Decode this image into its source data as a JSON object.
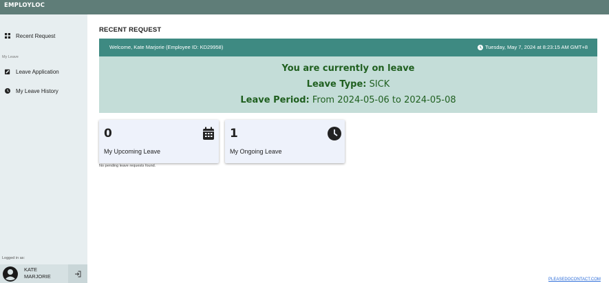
{
  "app": {
    "brand": "EMPLOYLOC"
  },
  "sidebar": {
    "items": [
      {
        "label": "Recent Request",
        "icon": "dashboard-icon"
      },
      {
        "label": "Leave Application",
        "icon": "edit-square-icon"
      },
      {
        "label": "My Leave History",
        "icon": "clock-icon"
      }
    ],
    "section_label": "My Leave",
    "logged_in_label": "Logged in as:",
    "user_name": "KATE MARJORIE"
  },
  "main": {
    "page_title": "RECENT REQUEST",
    "welcome": "Welcome, Kate Marjorie (Employee ID: KD29958)",
    "datetime": "Tuesday, May 7, 2024 at 8:23:15 AM GMT+8",
    "leave_status": {
      "headline": "You are currently on leave",
      "type_label": "Leave Type:",
      "type_value": "SICK",
      "period_label": "Leave Period:",
      "period_value": "From 2024-05-06 to 2024-05-08"
    },
    "cards": [
      {
        "count": "0",
        "caption": "My Upcoming Leave",
        "icon": "calendar-icon"
      },
      {
        "count": "1",
        "caption": "My Ongoing Leave",
        "icon": "clock-icon"
      }
    ],
    "no_pending": "No pending leave requests found."
  },
  "footer": {
    "link_text": "PLEASEDOCONTACT.COM"
  },
  "colors": {
    "topbar": "#5f7d78",
    "sidebar": "#e7eef0",
    "welcome_bar": "#3e8a82",
    "leave_panel": "#c4ddd8",
    "leave_text": "#1f5f1f",
    "card": "#eef2fb"
  }
}
